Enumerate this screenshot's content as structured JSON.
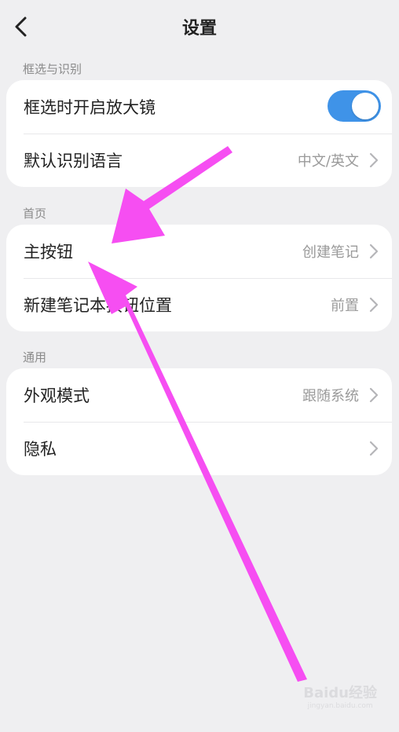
{
  "header": {
    "title": "设置"
  },
  "sections": [
    {
      "label": "框选与识别",
      "rows": [
        {
          "label": "框选时开启放大镜",
          "toggle": true
        },
        {
          "label": "默认识别语言",
          "value": "中文/英文"
        }
      ]
    },
    {
      "label": "首页",
      "rows": [
        {
          "label": "主按钮",
          "value": "创建笔记"
        },
        {
          "label": "新建笔记本按钮位置",
          "value": "前置"
        }
      ]
    },
    {
      "label": "通用",
      "rows": [
        {
          "label": "外观模式",
          "value": "跟随系统"
        },
        {
          "label": "隐私"
        }
      ]
    }
  ],
  "colors": {
    "accent": "#3f93e8",
    "annotation_arrow": "#f64ef2",
    "background": "#efeff1"
  },
  "watermark": {
    "text": "Baidu经验",
    "sub": "jingyan.baidu.com"
  }
}
